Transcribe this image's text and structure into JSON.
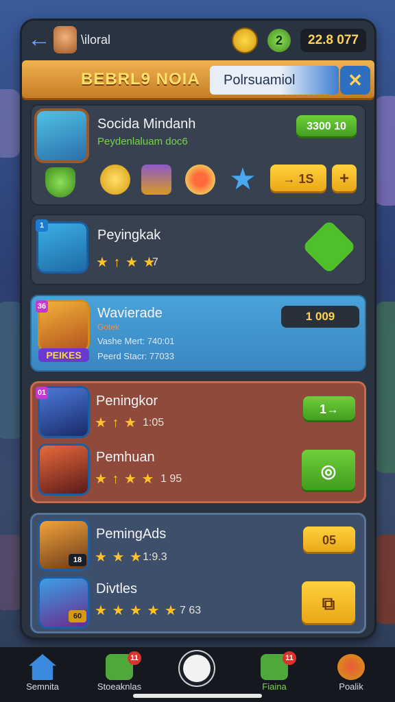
{
  "topbar": {
    "title": "\\iloral",
    "gem_value": "2",
    "score": "22.8 077"
  },
  "banner": {
    "title": "BEBRL9 NOIA",
    "search_text": "Polrsuamiol",
    "close_label": "✕"
  },
  "featured": {
    "name": "Socida Mindanh",
    "subtitle": "Peydenlaluam doc6",
    "price_button": "3300 10",
    "action_value": "→ 1S",
    "plus_label": "+"
  },
  "rows": [
    {
      "name": "Peyingkak",
      "stars": "★ ↑ ★ ★",
      "count": "7",
      "badge": ""
    },
    {
      "name": "Wavierade",
      "tag": "Gotek",
      "line1": "Vashe Mert: 740:01",
      "line2": "Peerd Stacr: 77033",
      "badge_text": "PEIKES",
      "pill_value": "1 009",
      "badge": "36"
    },
    {
      "name": "Peningkor",
      "stars": "★ ↑ ★",
      "count": "1:05",
      "badge": "01",
      "button": "1→"
    },
    {
      "name": "Pemhuan",
      "stars": "★ ↑ ★ ★",
      "count": "1 95",
      "badge": ""
    },
    {
      "name": "PemingAds",
      "stars": "★ ★ ★",
      "count": "1:9.3",
      "badge": "",
      "corner": "18",
      "button": "05"
    },
    {
      "name": "Divtles",
      "stars": "★ ★ ★ ★ ★",
      "count": "7 63",
      "badge": "",
      "corner": "60"
    }
  ],
  "nav": {
    "items": [
      {
        "label": "Semnita"
      },
      {
        "label": "Stoeaknlas",
        "badge": "11"
      },
      {
        "label": ""
      },
      {
        "label": "Fiaina",
        "badge": "11"
      },
      {
        "label": "Poalik"
      }
    ]
  },
  "colors": {
    "accent_green": "#6ecf3a",
    "accent_gold": "#ffd13e",
    "panel": "#2a3340",
    "card_blue": "#4aa3d8",
    "card_red": "#8f4a3c"
  }
}
